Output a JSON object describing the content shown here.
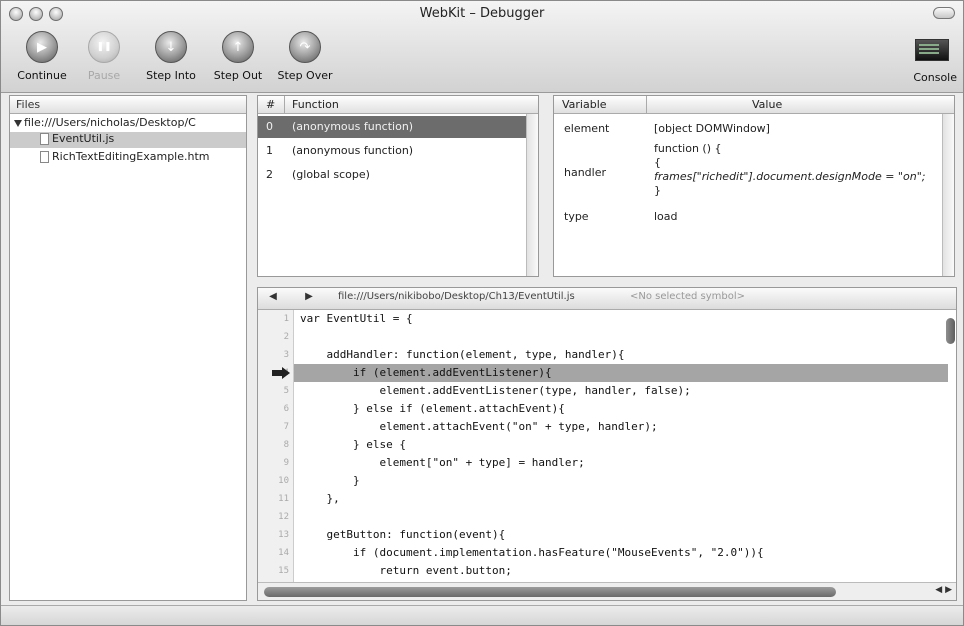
{
  "window": {
    "title": "WebKit – Debugger"
  },
  "toolbar": {
    "buttons": [
      {
        "label": "Continue",
        "icon": "play-icon",
        "glyph": "▶",
        "enabled": true
      },
      {
        "label": "Pause",
        "icon": "pause-icon",
        "glyph": "❚❚",
        "enabled": false
      },
      {
        "label": "Step Into",
        "icon": "step-into-icon",
        "glyph": "↓",
        "enabled": true
      },
      {
        "label": "Step Out",
        "icon": "step-out-icon",
        "glyph": "↑",
        "enabled": true
      },
      {
        "label": "Step Over",
        "icon": "step-over-icon",
        "glyph": "↷",
        "enabled": true
      }
    ],
    "console_label": "Console"
  },
  "files": {
    "header": "Files",
    "root": "file:///Users/nicholas/Desktop/C",
    "items": [
      "EventUtil.js",
      "RichTextEditingExample.htm"
    ]
  },
  "stack": {
    "col_num": "#",
    "col_function": "Function",
    "rows": [
      {
        "num": "0",
        "fn": "(anonymous function)"
      },
      {
        "num": "1",
        "fn": "(anonymous function)"
      },
      {
        "num": "2",
        "fn": "(global scope)"
      }
    ]
  },
  "variables": {
    "col_variable": "Variable",
    "col_value": "Value",
    "rows": [
      {
        "name": "element",
        "value": "[object DOMWindow]"
      },
      {
        "name": "handler",
        "value": "function () {"
      },
      {
        "name": "type",
        "value": "load"
      }
    ],
    "handler_line2": "{",
    "handler_line3": "frames[\"richedit\"].document.designMode = \"on\";",
    "handler_line4": "}"
  },
  "source": {
    "back": "◀",
    "forward": "▶",
    "path": "file:///Users/nikibobo/Desktop/Ch13/EventUtil.js",
    "selector": "<No selected symbol>",
    "current_line": 4,
    "lines": [
      "var EventUtil = {",
      "",
      "    addHandler: function(element, type, handler){",
      "        if (element.addEventListener){",
      "            element.addEventListener(type, handler, false);",
      "        } else if (element.attachEvent){",
      "            element.attachEvent(\"on\" + type, handler);",
      "        } else {",
      "            element[\"on\" + type] = handler;",
      "        }",
      "    },",
      "",
      "    getButton: function(event){",
      "        if (document.implementation.hasFeature(\"MouseEvents\", \"2.0\")){",
      "            return event.button;"
    ],
    "line_numbers": [
      "1",
      "2",
      "3",
      "4",
      "5",
      "6",
      "7",
      "8",
      "9",
      "10",
      "11",
      "12",
      "13",
      "14",
      "15"
    ],
    "scroll_arrows": "◀ ▶"
  }
}
